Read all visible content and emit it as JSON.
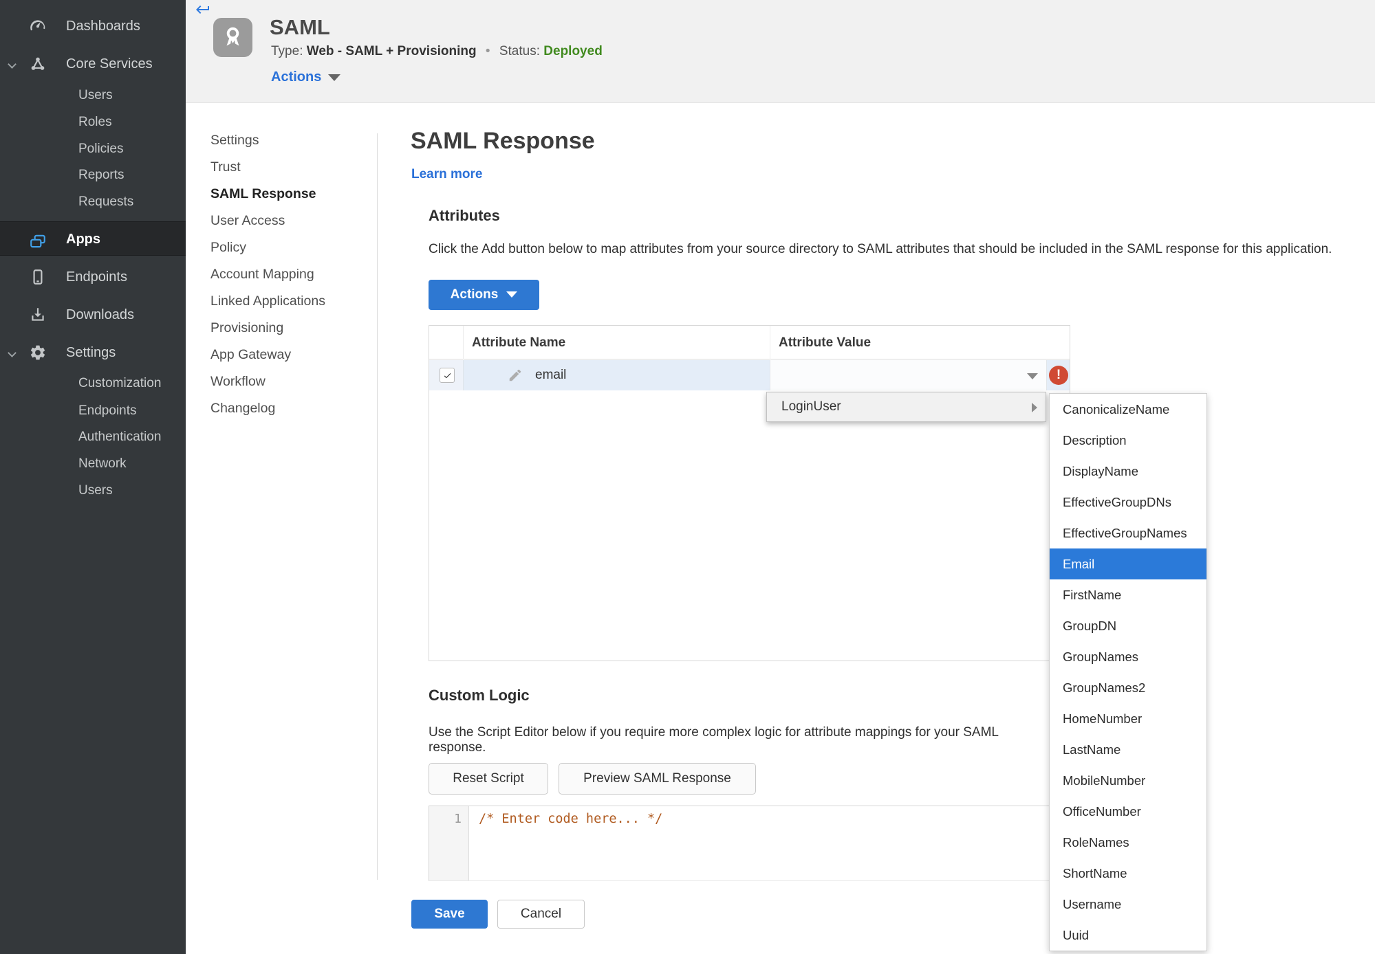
{
  "colors": {
    "accent_blue": "#2e78d2",
    "menu_highlight_blue": "#2b7ad9",
    "link_blue": "#2a70d8",
    "status_green": "#418a1f",
    "error_red": "#d04a34",
    "sidebar_bg": "#34383b",
    "header_band_bg": "#f1f1f1"
  },
  "icons": {
    "back": "keyboard-return-arrow",
    "app_badge": "award-ribbon",
    "dashboards": "gauge",
    "core_services": "node-triangle",
    "apps": "stacked-windows",
    "endpoints": "smartphone",
    "downloads": "download-tray",
    "settings": "gear",
    "edit": "pencil",
    "dropdown": "caret-down",
    "submenu": "caret-right",
    "error": "exclamation-circle"
  },
  "sidebar": {
    "dashboards": "Dashboards",
    "core_services": "Core Services",
    "core_children": [
      "Users",
      "Roles",
      "Policies",
      "Reports",
      "Requests"
    ],
    "apps": "Apps",
    "endpoints": "Endpoints",
    "downloads": "Downloads",
    "settings": "Settings",
    "settings_children": [
      "Customization",
      "Endpoints",
      "Authentication",
      "Network",
      "Users"
    ]
  },
  "header": {
    "title": "SAML",
    "type_label": "Type:",
    "type_value": "Web - SAML + Provisioning",
    "separator": "•",
    "status_label": "Status:",
    "status_value": "Deployed",
    "actions_label": "Actions"
  },
  "subnav": {
    "items": [
      "Settings",
      "Trust",
      "SAML Response",
      "User Access",
      "Policy",
      "Account Mapping",
      "Linked Applications",
      "Provisioning",
      "App Gateway",
      "Workflow",
      "Changelog"
    ],
    "active": "SAML Response"
  },
  "main": {
    "title": "SAML Response",
    "learn_more": "Learn more",
    "attributes": {
      "heading": "Attributes",
      "description": "Click the Add button below to map attributes from your source directory to SAML attributes that should be included in the SAML response for this application.",
      "actions_button": "Actions",
      "table": {
        "col_name": "Attribute Name",
        "col_value": "Attribute Value",
        "row": {
          "name": "email",
          "value": "",
          "checked": true,
          "error": "!"
        }
      }
    },
    "dropdown": {
      "menu_item": "LoginUser",
      "submenu": [
        "CanonicalizeName",
        "Description",
        "DisplayName",
        "EffectiveGroupDNs",
        "EffectiveGroupNames",
        "Email",
        "FirstName",
        "GroupDN",
        "GroupNames",
        "GroupNames2",
        "HomeNumber",
        "LastName",
        "MobileNumber",
        "OfficeNumber",
        "RoleNames",
        "ShortName",
        "Username",
        "Uuid"
      ],
      "selected": "Email"
    },
    "custom_logic": {
      "heading": "Custom Logic",
      "description": "Use the Script Editor below if you require more complex logic for attribute mappings for your SAML response.",
      "reset_button": "Reset Script",
      "preview_button": "Preview SAML Response",
      "editor": {
        "line_number": "1",
        "code": "/* Enter code here... */"
      }
    },
    "footer": {
      "save": "Save",
      "cancel": "Cancel"
    }
  }
}
